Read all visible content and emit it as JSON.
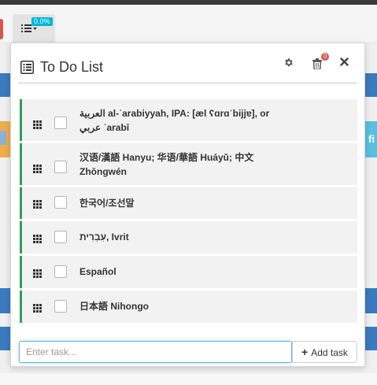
{
  "toolbar": {
    "progress_badge": "0.0%",
    "list_icon": "list-icon"
  },
  "panel": {
    "title": "To Do List",
    "title_icon": "list-alt-icon",
    "settings_icon": "gear-icon",
    "trash_icon": "trash-icon",
    "trash_count": "0",
    "close_icon": "close-icon"
  },
  "tasks": [
    {
      "text_line1": "العربية al-ʿarabiyyah, IPA: [æl ʕɑrɑˈbijjɐ], or",
      "text_line2": "عربي ʿarabī",
      "done": false
    },
    {
      "text_line1": "汉语/漢語 Hanyu; 华语/華語 Huáyǔ; 中文",
      "text_line2": "Zhōngwén",
      "done": false
    },
    {
      "text_line1": "한국어/조선말",
      "text_line2": "",
      "done": false
    },
    {
      "text_line1": "עִבְרִית, Ivrit",
      "text_line2": "",
      "done": false
    },
    {
      "text_line1": "Español",
      "text_line2": "",
      "done": false
    },
    {
      "text_line1": "日本語 Nihongo",
      "text_line2": "",
      "done": false
    }
  ],
  "add_task": {
    "input_value": "",
    "placeholder": "Enter task...",
    "button_label": "Add task"
  },
  "background": {
    "fi_text": "fi"
  },
  "colors": {
    "accent_green": "#2e9e5b",
    "badge_cyan": "#00b4d8",
    "badge_red": "#d9534f",
    "input_focus": "#66afe9"
  }
}
